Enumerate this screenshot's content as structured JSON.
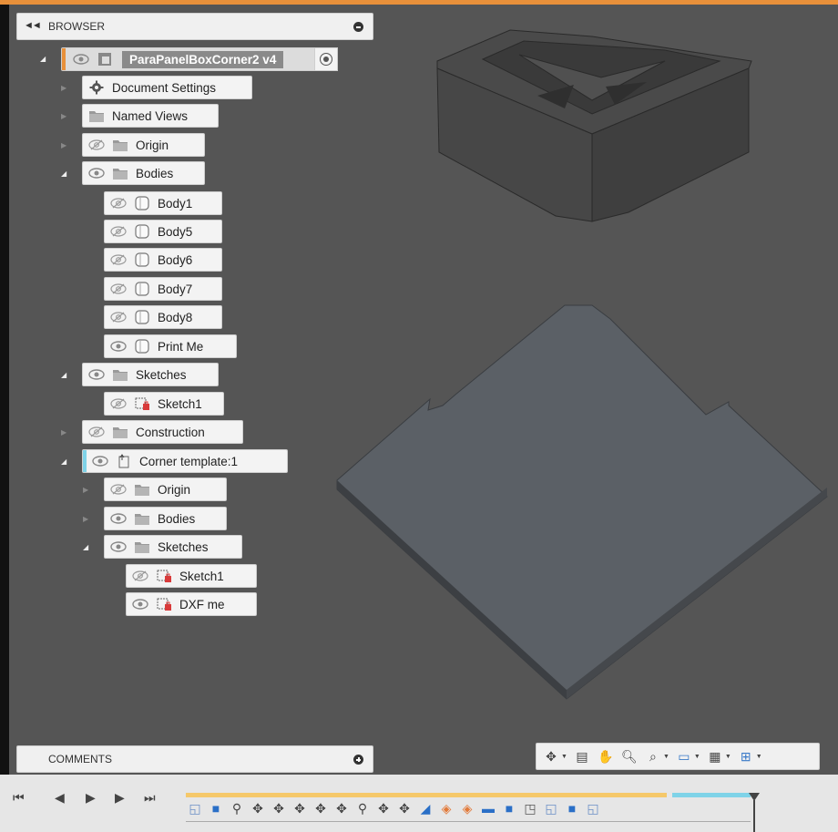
{
  "browser": {
    "title": "BROWSER",
    "root": {
      "label": "ParaPanelBoxCorner2 v4"
    },
    "items": [
      {
        "label": "Document Settings"
      },
      {
        "label": "Named Views"
      },
      {
        "label": "Origin"
      },
      {
        "label": "Bodies"
      },
      {
        "label": "Body1"
      },
      {
        "label": "Body5"
      },
      {
        "label": "Body6"
      },
      {
        "label": "Body7"
      },
      {
        "label": "Body8"
      },
      {
        "label": "Print Me"
      },
      {
        "label": "Sketches"
      },
      {
        "label": "Sketch1"
      },
      {
        "label": "Construction"
      },
      {
        "label": "Corner template:1"
      },
      {
        "label": "Origin"
      },
      {
        "label": "Bodies"
      },
      {
        "label": "Sketches"
      },
      {
        "label": "Sketch1"
      },
      {
        "label": "DXF me"
      }
    ]
  },
  "comments": {
    "title": "COMMENTS"
  },
  "colors": {
    "accent_orange": "#e8903a",
    "accent_cyan": "#7fd3e8",
    "timeline_yellow": "#f5c86a",
    "viewport_bg": "#555555",
    "sketch_lock_red": "#d93a3a"
  }
}
